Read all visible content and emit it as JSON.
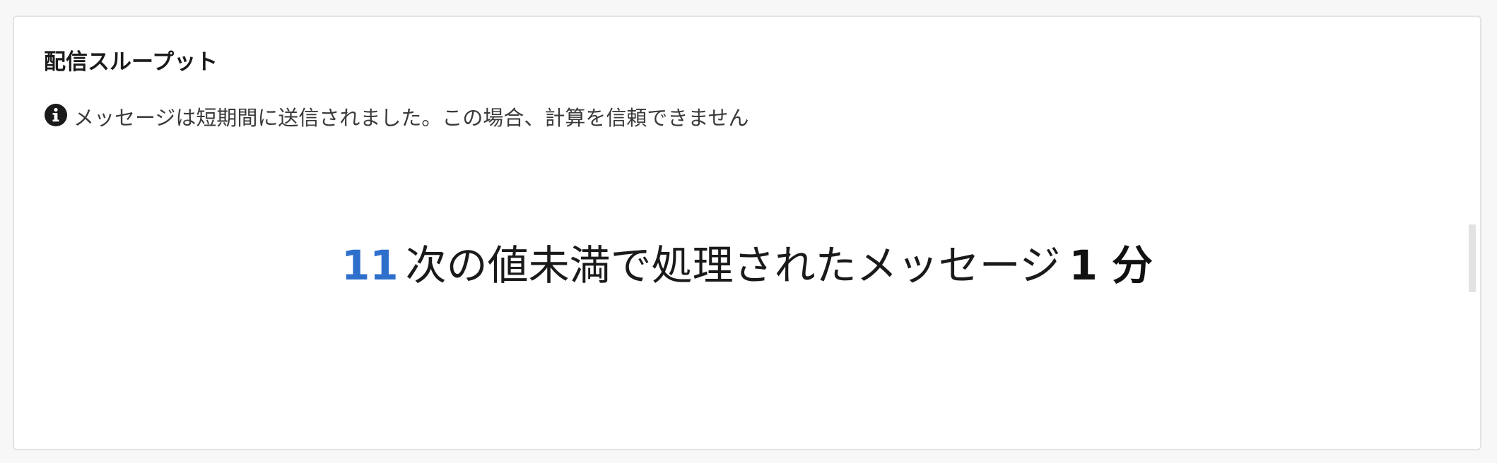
{
  "card": {
    "title": "配信スループット",
    "notice": {
      "icon": "info-icon",
      "text": "メッセージは短期間に送信されました。この場合、計算を信頼できません"
    },
    "metric": {
      "value": "11",
      "label": "次の値未満で処理されたメッセージ",
      "threshold": "1 分"
    }
  },
  "colors": {
    "accent": "#2e6fcc",
    "text": "#1a1a1a",
    "card_border": "#e3e3e3",
    "page_background": "#f7f7f7"
  }
}
